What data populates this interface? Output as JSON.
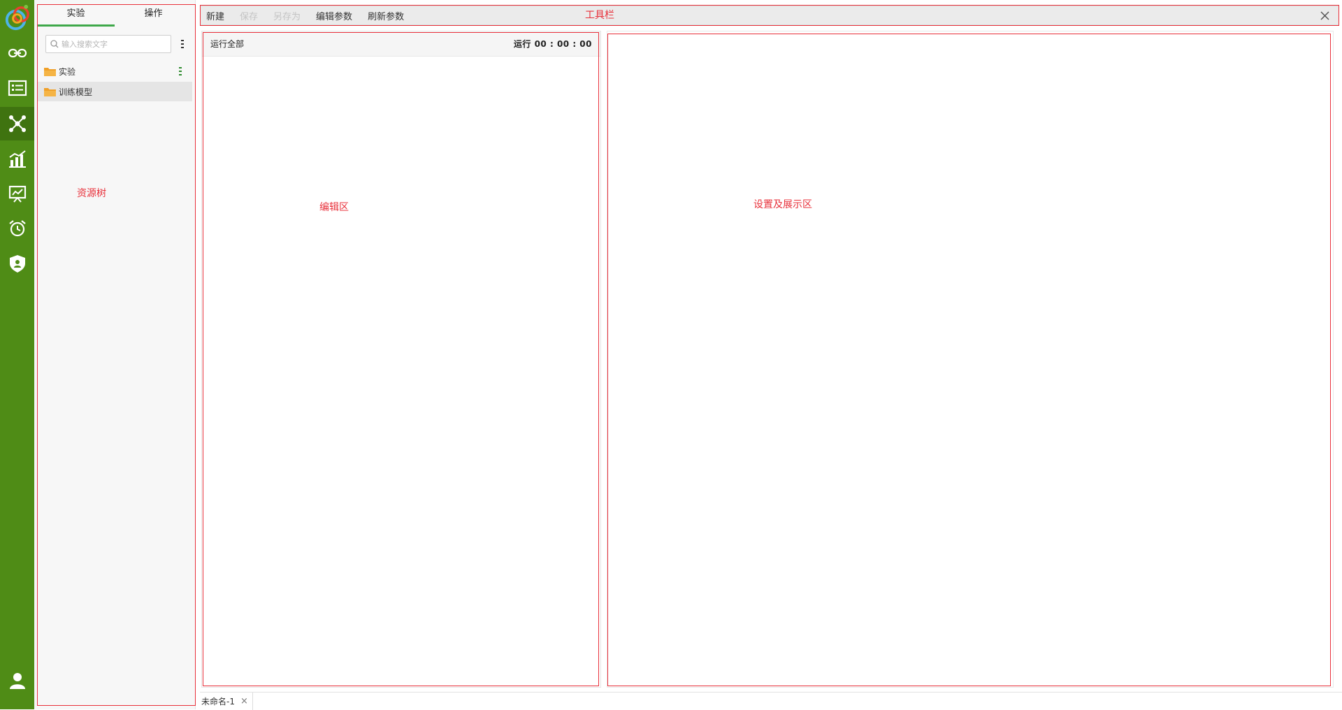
{
  "rail": {
    "items": [
      {
        "icon": "link-icon"
      },
      {
        "icon": "list-card-icon"
      },
      {
        "icon": "network-icon",
        "active": true
      },
      {
        "icon": "bar-chart-icon"
      },
      {
        "icon": "presentation-chart-icon"
      },
      {
        "icon": "alarm-clock-icon"
      },
      {
        "icon": "shield-user-icon"
      }
    ],
    "bottom_icon": "user-icon",
    "color": "#4f8c16",
    "active_color": "#3f7310"
  },
  "tree": {
    "tabs": [
      {
        "label": "实验",
        "active": true
      },
      {
        "label": "操作",
        "active": false
      }
    ],
    "search": {
      "placeholder": "输入搜索文字",
      "value": ""
    },
    "items": [
      {
        "label": "实验",
        "selected": false
      },
      {
        "label": "训练模型",
        "selected": true
      }
    ],
    "annotation": "资源树"
  },
  "toolbar": {
    "buttons": [
      {
        "label": "新建",
        "enabled": true
      },
      {
        "label": "保存",
        "enabled": false
      },
      {
        "label": "另存为",
        "enabled": false
      },
      {
        "label": "编辑参数",
        "enabled": true
      },
      {
        "label": "刷新参数",
        "enabled": true
      }
    ],
    "annotation": "工具栏"
  },
  "edit": {
    "run_all_label": "运行全部",
    "timer_label": "运行 00 : 00 : 00",
    "annotation": "编辑区"
  },
  "settings": {
    "annotation": "设置及展示区"
  },
  "doc_tabs": [
    {
      "label": "未命名-1"
    }
  ],
  "colors": {
    "accent": "#3fa84a",
    "annotation": "#e8303a",
    "folder": "#f0a029"
  }
}
